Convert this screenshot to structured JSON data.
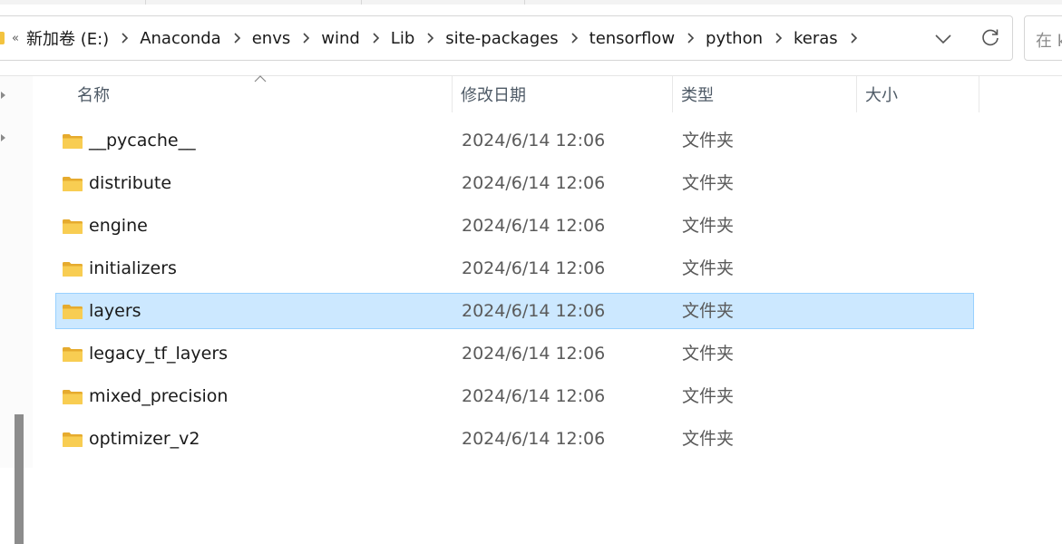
{
  "address": {
    "overflow_label": "«",
    "crumbs": [
      "新加卷 (E:)",
      "Anaconda",
      "envs",
      "wind",
      "Lib",
      "site-packages",
      "tensorflow",
      "python",
      "keras"
    ]
  },
  "search": {
    "placeholder_partial": "在 k"
  },
  "columns": {
    "name": "名称",
    "date": "修改日期",
    "type": "类型",
    "size": "大小"
  },
  "files": [
    {
      "name": "__pycache__",
      "date": "2024/6/14 12:06",
      "type": "文件夹",
      "selected": false
    },
    {
      "name": "distribute",
      "date": "2024/6/14 12:06",
      "type": "文件夹",
      "selected": false
    },
    {
      "name": "engine",
      "date": "2024/6/14 12:06",
      "type": "文件夹",
      "selected": false
    },
    {
      "name": "initializers",
      "date": "2024/6/14 12:06",
      "type": "文件夹",
      "selected": false
    },
    {
      "name": "layers",
      "date": "2024/6/14 12:06",
      "type": "文件夹",
      "selected": true
    },
    {
      "name": "legacy_tf_layers",
      "date": "2024/6/14 12:06",
      "type": "文件夹",
      "selected": false
    },
    {
      "name": "mixed_precision",
      "date": "2024/6/14 12:06",
      "type": "文件夹",
      "selected": false
    },
    {
      "name": "optimizer_v2",
      "date": "2024/6/14 12:06",
      "type": "文件夹",
      "selected": false
    }
  ],
  "colors": {
    "selection_bg": "#cce8ff",
    "selection_border": "#99d1ff",
    "folder": "#f3c33f"
  }
}
